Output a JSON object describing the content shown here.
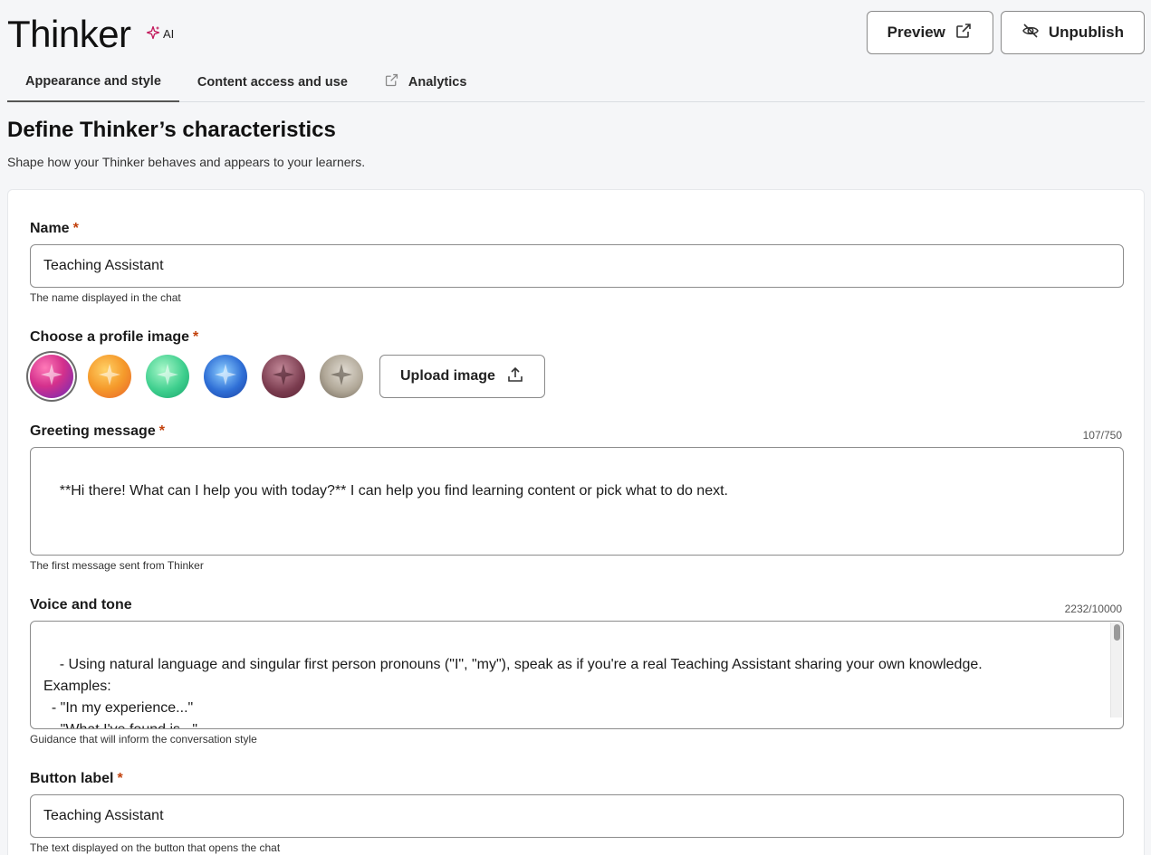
{
  "header": {
    "title": "Thinker",
    "ai_badge": "AI",
    "preview_label": "Preview",
    "unpublish_label": "Unpublish"
  },
  "tabs": [
    {
      "label": "Appearance and style",
      "active": true
    },
    {
      "label": "Content access and use",
      "active": false
    },
    {
      "label": "Analytics",
      "active": false
    }
  ],
  "page": {
    "heading": "Define Thinker’s characteristics",
    "subheading": "Shape how your Thinker behaves and appears to your learners."
  },
  "form": {
    "name": {
      "label": "Name",
      "required_mark": "*",
      "value": "Teaching Assistant",
      "helper": "The name displayed in the chat"
    },
    "profile_image": {
      "label": "Choose a profile image",
      "required_mark": "*",
      "upload_label": "Upload image",
      "options": [
        {
          "color": "#d4308c",
          "selected": true
        },
        {
          "color": "#f59a2b",
          "selected": false
        },
        {
          "color": "#3fcf8e",
          "selected": false
        },
        {
          "color": "#2f6fd6",
          "selected": false
        },
        {
          "color": "#7a3b4e",
          "selected": false
        },
        {
          "color": "#7d7468",
          "selected": false
        }
      ]
    },
    "greeting": {
      "label": "Greeting message",
      "required_mark": "*",
      "counter": "107/750",
      "value": "**Hi there! What can I help you with today?** I can help you find learning content or pick what to do next.",
      "helper": "The first message sent from Thinker"
    },
    "voice": {
      "label": "Voice and tone",
      "counter": "2232/10000",
      "value": "- Using natural language and singular first person pronouns (\"I\", \"my\"), speak as if you're a real Teaching Assistant sharing your own knowledge.\nExamples:\n  - \"In my experience...\"\n  - \"What I've found is...\"\n  - \"The key thing to understand is...\"",
      "helper": "Guidance that will inform the conversation style"
    },
    "button_label": {
      "label": "Button label",
      "required_mark": "*",
      "value": "Teaching Assistant",
      "helper": "The text displayed on the button that opens the chat"
    }
  }
}
